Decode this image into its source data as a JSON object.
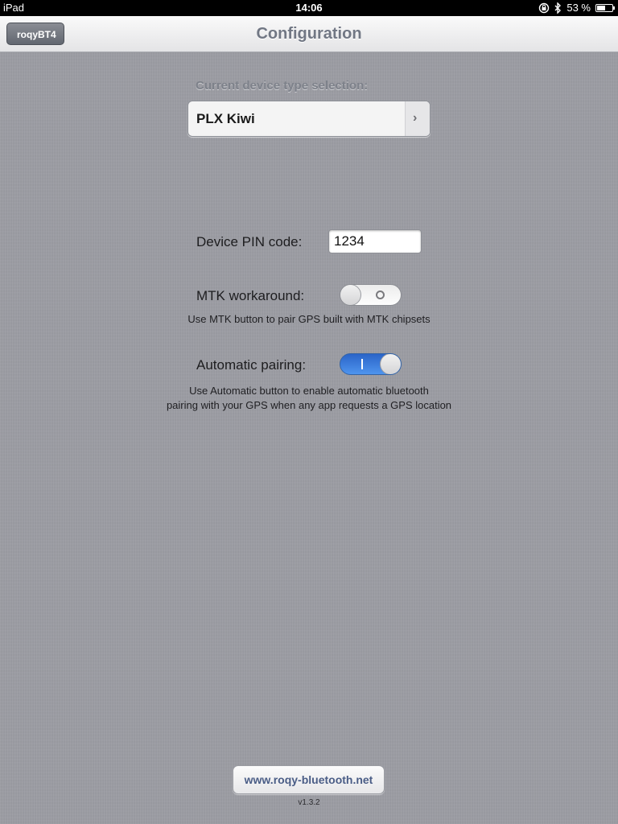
{
  "status_bar": {
    "device": "iPad",
    "time": "14:06",
    "battery_percent": "53 %",
    "battery_level": 0.53,
    "icons": [
      "orientation-lock-icon",
      "bluetooth-icon",
      "battery-icon"
    ]
  },
  "nav": {
    "title": "Configuration",
    "back_label": "roqyBT4"
  },
  "device_selection": {
    "label": "Current device type selection:",
    "value": "PLX Kiwi"
  },
  "pin": {
    "label": "Device PIN code:",
    "value": "1234"
  },
  "mtk": {
    "label": "MTK workaround:",
    "enabled": false,
    "description": "Use MTK button to pair GPS built with MTK chipsets"
  },
  "auto_pairing": {
    "label": "Automatic pairing:",
    "enabled": true,
    "description_line1": "Use Automatic button to enable automatic bluetooth",
    "description_line2": "pairing with your GPS when any app requests a GPS location"
  },
  "footer": {
    "link_label": "www.roqy-bluetooth.net",
    "version": "v1.3.2"
  },
  "colors": {
    "background": "#9c9da4",
    "toggle_on": "#3a7ee0",
    "link_text": "#4a5d86"
  }
}
